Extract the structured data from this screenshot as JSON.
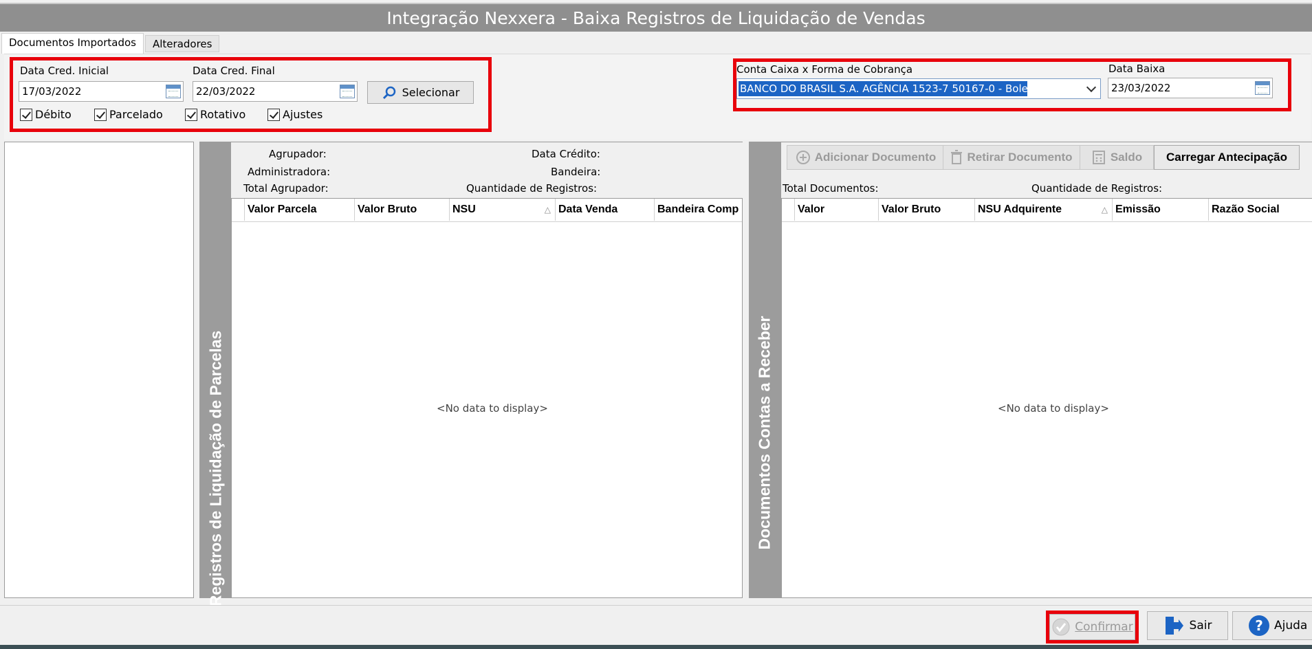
{
  "window": {
    "title": "Integração Nexxera - Baixa Registros de Liquidação de Vendas"
  },
  "tabs": [
    {
      "label": "Documentos Importados",
      "active": true
    },
    {
      "label": "Alteradores",
      "active": false
    }
  ],
  "filters": {
    "data_cred_inicial_label": "Data Cred. Inicial",
    "data_cred_inicial_value": "17/03/2022",
    "data_cred_final_label": "Data Cred. Final",
    "data_cred_final_value": "22/03/2022",
    "selecionar_label": "Selecionar",
    "checkboxes": [
      {
        "label": "Débito",
        "checked": true
      },
      {
        "label": "Parcelado",
        "checked": true
      },
      {
        "label": "Rotativo",
        "checked": true
      },
      {
        "label": "Ajustes",
        "checked": true
      }
    ]
  },
  "conta": {
    "label": "Conta Caixa x Forma de Cobrança",
    "value": "BANCO DO BRASIL S.A. AGÊNCIA 1523-7 50167-0 - Bole",
    "data_baixa_label": "Data Baixa",
    "data_baixa_value": "23/03/2022"
  },
  "registros": {
    "vertical_title": "Registros de Liquidação de Parcelas",
    "agrupador_label": "Agrupador:",
    "administradora_label": "Administradora:",
    "total_agrupador_label": "Total Agrupador:",
    "data_credito_label": "Data Crédito:",
    "bandeira_label": "Bandeira:",
    "qtd_registros_label": "Quantidade de Registros:",
    "columns": [
      "Valor Parcela",
      "Valor Bruto",
      "NSU",
      "Data Venda",
      "Bandeira Comp"
    ],
    "sorted_column_indicator": "△",
    "empty_text": "<No data to display>"
  },
  "documentos": {
    "vertical_title": "Documentos Contas a Receber",
    "adicionar_label": "Adicionar Documento",
    "retirar_label": "Retirar Documento",
    "saldo_label": "Saldo",
    "carregar_label": "Carregar Antecipação",
    "total_documentos_label": "Total Documentos:",
    "qtd_registros_label": "Quantidade de Registros:",
    "columns": [
      "Valor",
      "Valor Bruto",
      "NSU Adquirente",
      "Emissão",
      "Razão Social"
    ],
    "sorted_column_indicator": "△",
    "empty_text": "<No data to display>"
  },
  "footer": {
    "confirmar_label": "Confirmar",
    "sair_label": "Sair",
    "ajuda_label": "Ajuda"
  }
}
